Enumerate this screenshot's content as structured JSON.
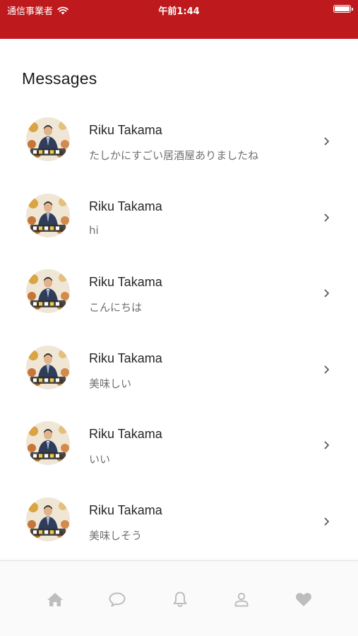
{
  "status_bar": {
    "carrier": "通信事業者",
    "time": "午前1:44",
    "background_color": "#be1a1e"
  },
  "page": {
    "title": "Messages"
  },
  "messages": [
    {
      "name": "Riku Takama",
      "preview": "たしかにすごい居酒屋ありましたね"
    },
    {
      "name": "Riku Takama",
      "preview": "hi"
    },
    {
      "name": "Riku Takama",
      "preview": "こんにちは"
    },
    {
      "name": "Riku Takama",
      "preview": "美味しい"
    },
    {
      "name": "Riku Takama",
      "preview": "いい"
    },
    {
      "name": "Riku Takama",
      "preview": "美味しそう"
    }
  ],
  "tab_bar": {
    "tabs": [
      {
        "icon": "home-icon"
      },
      {
        "icon": "chat-bubble-icon"
      },
      {
        "icon": "bell-icon"
      },
      {
        "icon": "person-icon"
      },
      {
        "icon": "heart-icon"
      }
    ],
    "icon_color": "#bdbdbd"
  }
}
